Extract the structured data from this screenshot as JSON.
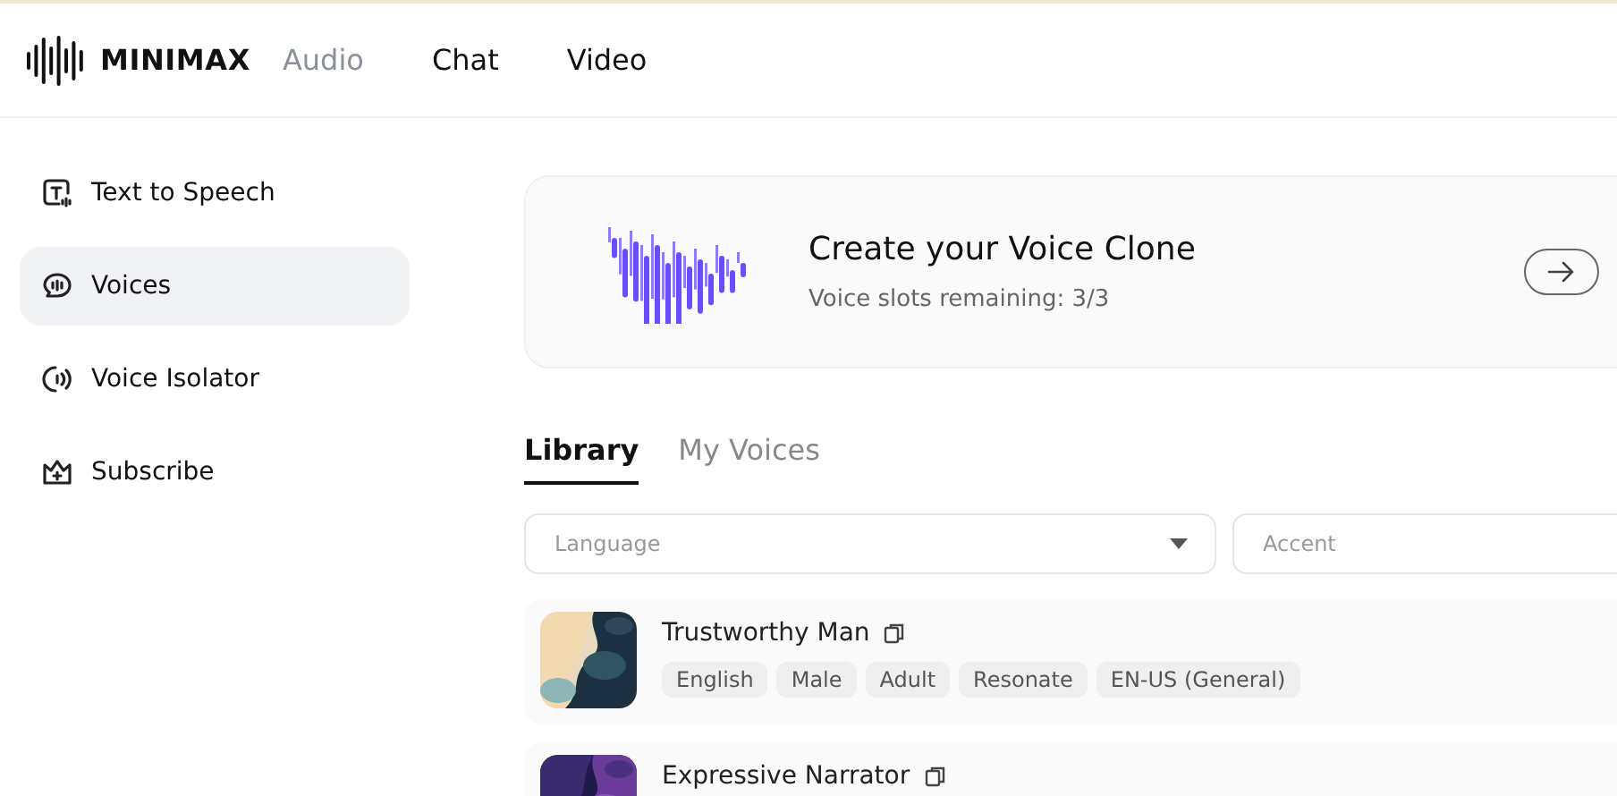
{
  "brand": {
    "name": "MINIMAX"
  },
  "nav": [
    {
      "label": "Audio",
      "selected": true
    },
    {
      "label": "Chat",
      "selected": false
    },
    {
      "label": "Video",
      "selected": false
    }
  ],
  "sidebar": {
    "items": [
      {
        "label": "Text to Speech",
        "kind": "tts",
        "selected": false
      },
      {
        "label": "Voices",
        "kind": "voices",
        "selected": true
      },
      {
        "label": "Voice Isolator",
        "kind": "isolator",
        "selected": false
      },
      {
        "label": "Subscribe",
        "kind": "crown",
        "selected": false
      }
    ]
  },
  "clone_card": {
    "title": "Create your Voice Clone",
    "subtitle": "Voice slots remaining: 3/3"
  },
  "tabs": [
    {
      "label": "Library",
      "selected": true
    },
    {
      "label": "My Voices",
      "selected": false
    }
  ],
  "filters": [
    {
      "placeholder": "Language",
      "dropdown": true
    },
    {
      "placeholder": "Accent"
    }
  ],
  "voices": [
    {
      "name": "Trustworthy Man",
      "tags": [
        "English",
        "Male",
        "Adult",
        "Resonate",
        "EN-US (General)"
      ]
    },
    {
      "name": "Expressive Narrator"
    }
  ]
}
